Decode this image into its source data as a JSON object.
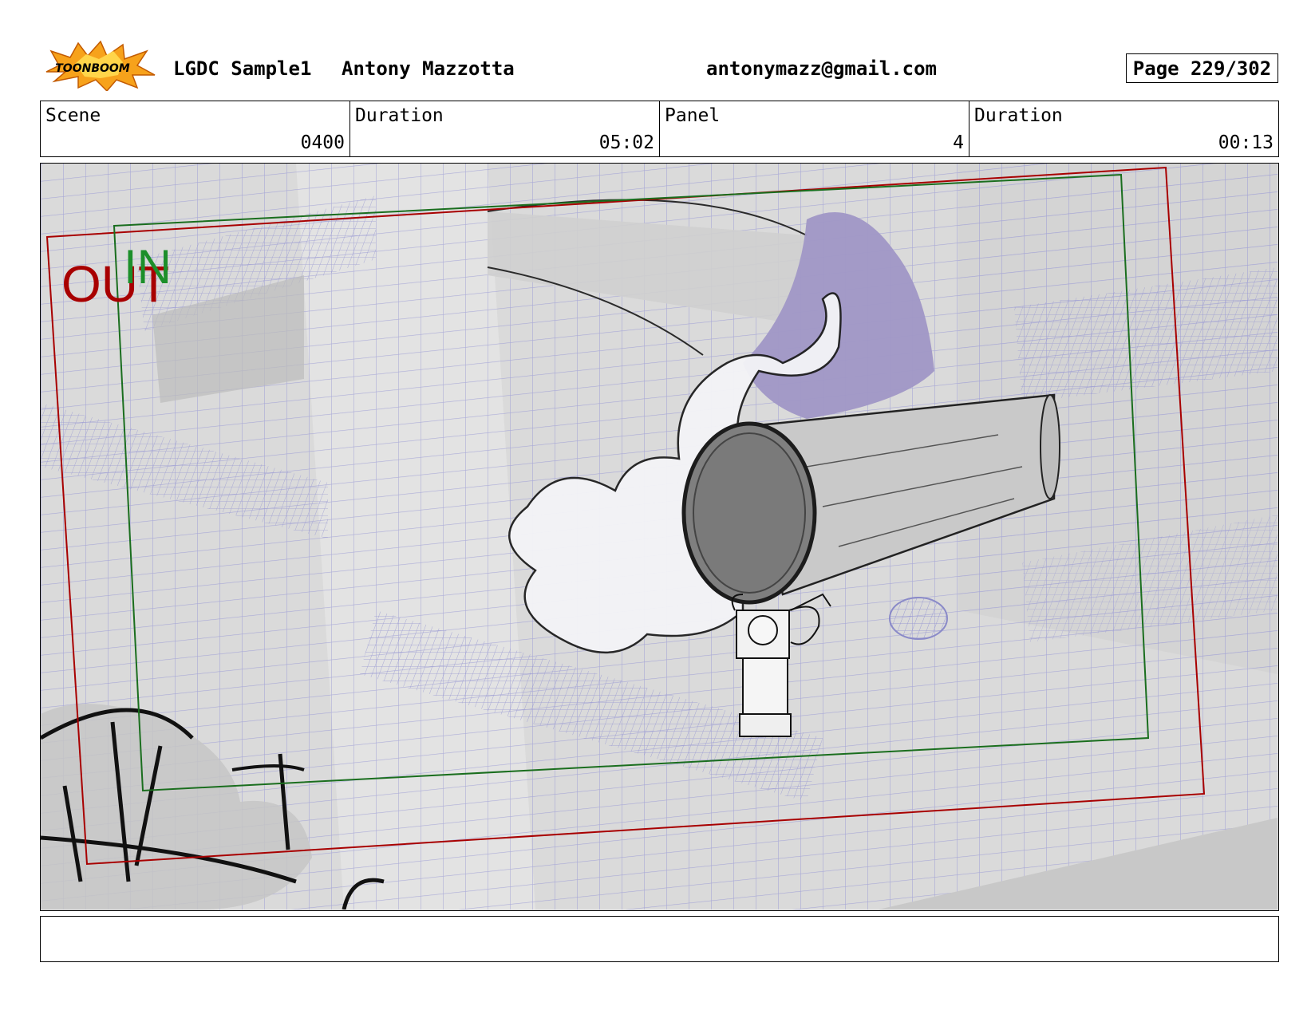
{
  "header": {
    "logo_text": "TOONBOOM",
    "project": "LGDC Sample1",
    "author": "Antony Mazzotta",
    "email": "antonymazz@gmail.com",
    "page": "Page 229/302"
  },
  "info": {
    "scene_label": "Scene",
    "scene_value": "0400",
    "scene_duration_label": "Duration",
    "scene_duration_value": "05:02",
    "panel_label": "Panel",
    "panel_value": "4",
    "panel_duration_label": "Duration",
    "panel_duration_value": "00:13"
  },
  "panel_overlay": {
    "out_label": "OUT",
    "in_label": "IN",
    "out_color": "#a80000",
    "in_color": "#1c8f2a"
  },
  "notes": {
    "text": ""
  }
}
